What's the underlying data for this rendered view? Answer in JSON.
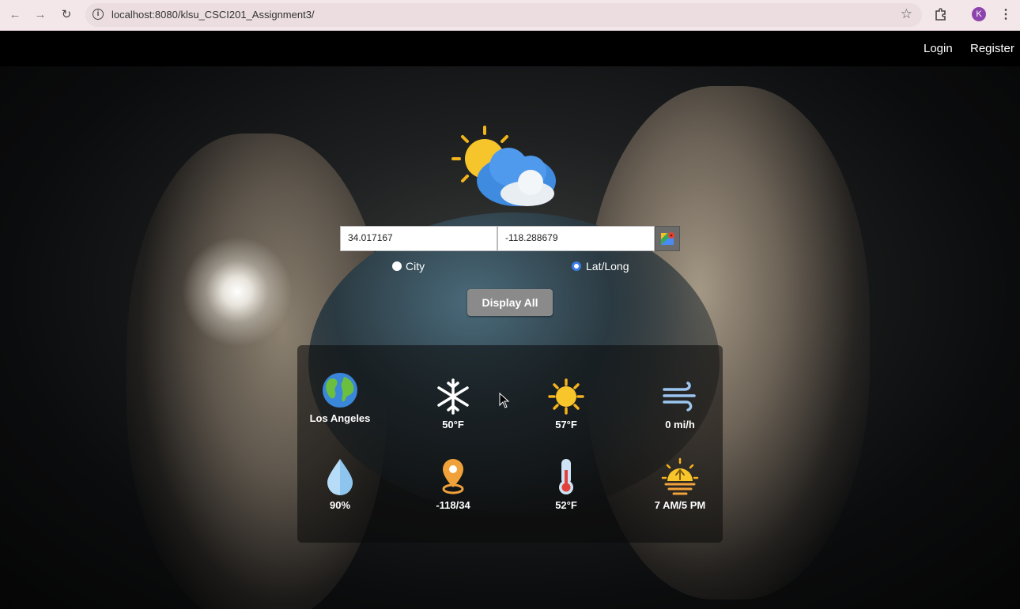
{
  "browser": {
    "url": "localhost:8080/klsu_CSCI201_Assignment3/",
    "avatar_letter": "K"
  },
  "nav": {
    "login": "Login",
    "register": "Register"
  },
  "search": {
    "latitude_value": "34.017167",
    "longitude_value": "-118.288679",
    "mode_options": [
      "City",
      "Lat/Long"
    ],
    "selected_mode": "Lat/Long",
    "display_all_label": "Display All"
  },
  "weather": {
    "city": "Los Angeles",
    "low_temp": "50°F",
    "high_temp": "57°F",
    "wind": "0 mi/h",
    "humidity": "90%",
    "coordinates": "-118/34",
    "current_temp": "52°F",
    "sunrise_sunset": "7 AM/5 PM"
  },
  "colors": {
    "accent_radio": "#3d7de8",
    "button_gray": "#8a8a8a"
  }
}
